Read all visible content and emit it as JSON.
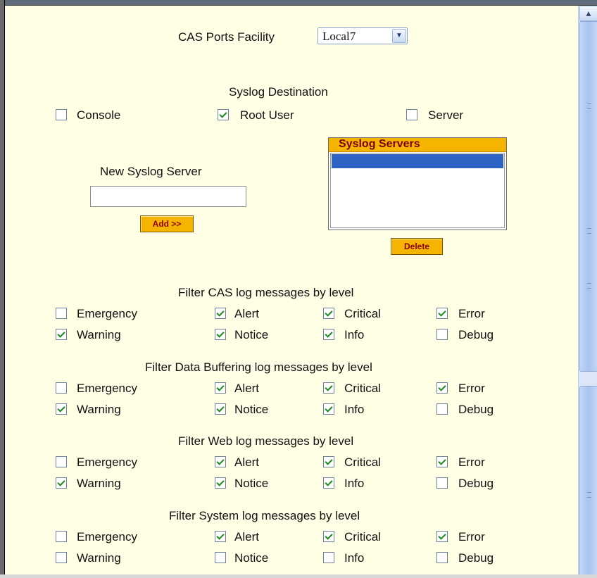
{
  "facility": {
    "label": "CAS Ports Facility",
    "selected": "Local7"
  },
  "syslog_destination": {
    "title": "Syslog Destination",
    "options": [
      {
        "label": "Console",
        "checked": false
      },
      {
        "label": "Root User",
        "checked": true
      },
      {
        "label": "Server",
        "checked": false
      }
    ]
  },
  "new_server": {
    "title": "New Syslog Server",
    "value": "",
    "add_label": "Add >>"
  },
  "servers": {
    "title": "Syslog Servers",
    "delete_label": "Delete"
  },
  "filters": [
    {
      "title": "Filter CAS log messages by level",
      "levels": [
        {
          "label": "Emergency",
          "checked": false
        },
        {
          "label": "Alert",
          "checked": true
        },
        {
          "label": "Critical",
          "checked": true
        },
        {
          "label": "Error",
          "checked": true
        },
        {
          "label": "Warning",
          "checked": true
        },
        {
          "label": "Notice",
          "checked": true
        },
        {
          "label": "Info",
          "checked": true
        },
        {
          "label": "Debug",
          "checked": false
        }
      ]
    },
    {
      "title": "Filter Data Buffering log messages by level",
      "levels": [
        {
          "label": "Emergency",
          "checked": false
        },
        {
          "label": "Alert",
          "checked": true
        },
        {
          "label": "Critical",
          "checked": true
        },
        {
          "label": "Error",
          "checked": true
        },
        {
          "label": "Warning",
          "checked": true
        },
        {
          "label": "Notice",
          "checked": true
        },
        {
          "label": "Info",
          "checked": true
        },
        {
          "label": "Debug",
          "checked": false
        }
      ]
    },
    {
      "title": "Filter Web log messages by level",
      "levels": [
        {
          "label": "Emergency",
          "checked": false
        },
        {
          "label": "Alert",
          "checked": true
        },
        {
          "label": "Critical",
          "checked": true
        },
        {
          "label": "Error",
          "checked": true
        },
        {
          "label": "Warning",
          "checked": true
        },
        {
          "label": "Notice",
          "checked": true
        },
        {
          "label": "Info",
          "checked": true
        },
        {
          "label": "Debug",
          "checked": false
        }
      ]
    },
    {
      "title": "Filter System log messages by level",
      "levels": [
        {
          "label": "Emergency",
          "checked": false
        },
        {
          "label": "Alert",
          "checked": true
        },
        {
          "label": "Critical",
          "checked": true
        },
        {
          "label": "Error",
          "checked": true
        },
        {
          "label": "Warning",
          "checked": false
        },
        {
          "label": "Notice",
          "checked": false
        },
        {
          "label": "Info",
          "checked": false
        },
        {
          "label": "Debug",
          "checked": false
        }
      ]
    }
  ],
  "icons": {
    "dropdown": "chevron-down-icon",
    "scroll_up": "scroll-up-arrow-icon",
    "checkmark": "checkmark-icon"
  },
  "colors": {
    "page_bg": "#ffffe6",
    "button_bg": "#f5b400",
    "button_text": "#8b0000",
    "selection": "#2e63c5",
    "check": "#1d8a1d"
  }
}
